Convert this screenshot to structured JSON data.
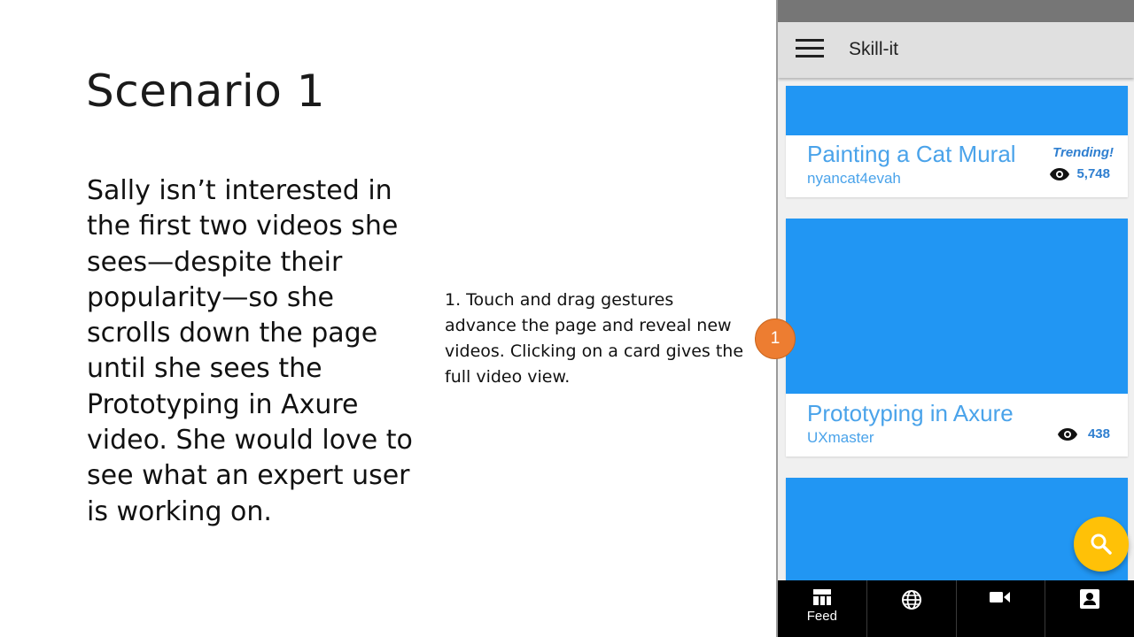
{
  "slide": {
    "title": "Scenario 1",
    "body": "Sally isn’t interested in the first two videos she sees—despite their popularity—so she scrolls down the page until she sees the Prototyping in Axure video. She would love to see what an expert user is working on.",
    "note": "1. Touch and drag gestures advance the page and reveal new videos. Clicking on a card gives the full video view.",
    "marker": "1",
    "marker_color": "#ed7d31"
  },
  "app": {
    "title": "Skill-it",
    "accent": "#2196f3",
    "fab_color": "#ffc107",
    "cards": [
      {
        "title": "Painting a Cat Mural",
        "author": "nyancat4evah",
        "badge": "Trending!",
        "views": "5,748"
      },
      {
        "title": "Prototyping in Axure",
        "author": "UXmaster",
        "views": "438"
      }
    ],
    "nav": [
      {
        "icon": "feed-icon",
        "label": "Feed"
      },
      {
        "icon": "globe-icon"
      },
      {
        "icon": "video-camera-icon"
      },
      {
        "icon": "account-box-icon"
      }
    ],
    "fab_icon": "search-icon",
    "menu_icon": "menu-icon"
  }
}
